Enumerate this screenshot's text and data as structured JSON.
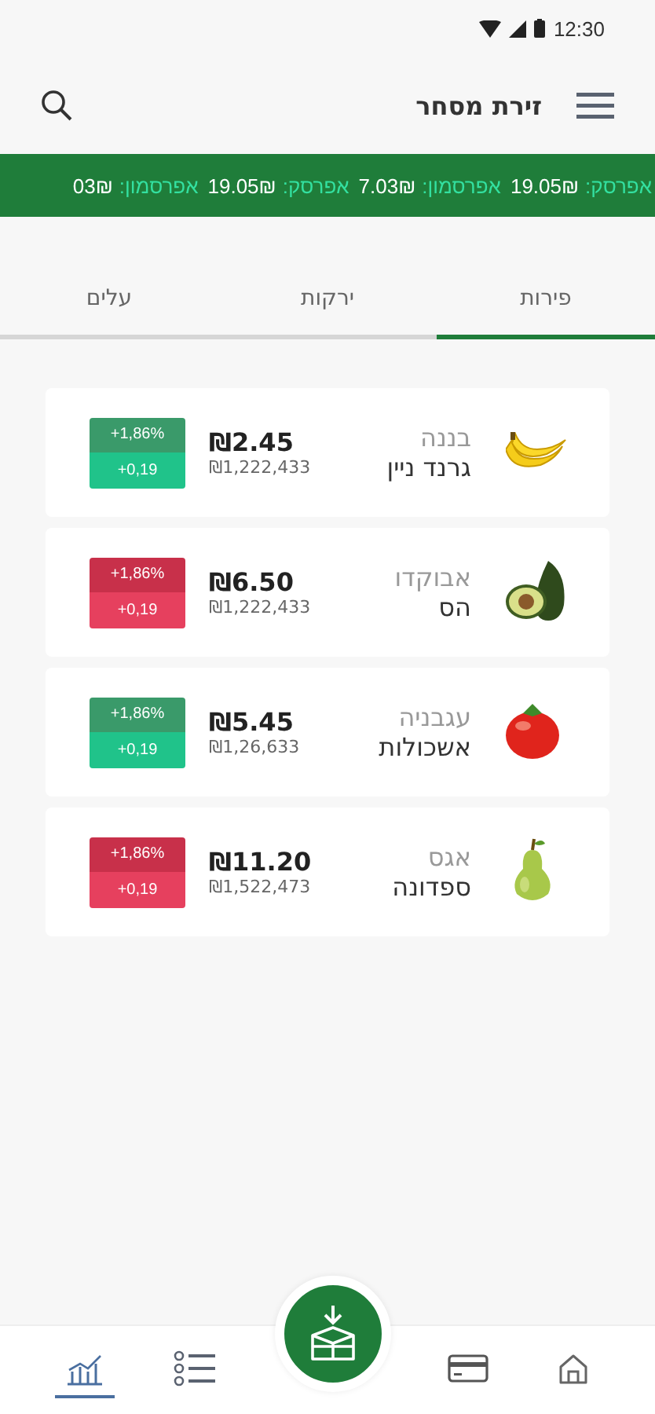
{
  "status_bar": {
    "time": "12:30"
  },
  "header": {
    "title": "זירת מסחר"
  },
  "ticker": [
    {
      "label": "אפרסק:",
      "value": "19.05₪"
    },
    {
      "label": "אפרסמון:",
      "value": "7.03₪"
    },
    {
      "label": "אפרסק:",
      "value": "19.05₪"
    },
    {
      "label": "אפרסמון:",
      "value": "03₪"
    }
  ],
  "tabs": [
    {
      "label": "פירות",
      "selected": true
    },
    {
      "label": "ירקות",
      "selected": false
    },
    {
      "label": "עלים",
      "selected": false
    }
  ],
  "products": [
    {
      "kind": "banana",
      "category": "בננה",
      "name": "גרנד ניין",
      "price": "₪2.45",
      "volume": "₪1,222,433",
      "rising": true,
      "change_percent": "+1,86%",
      "change": "+0,19"
    },
    {
      "kind": "avocado",
      "category": "אבוקדו",
      "name": "הס",
      "price": "₪6.50",
      "volume": "₪1,222,433",
      "rising": false,
      "change_percent": "+1,86%",
      "change": "+0,19"
    },
    {
      "kind": "tomato",
      "category": "עגבניה",
      "name": "אשכולות",
      "price": "₪5.45",
      "volume": "₪1,26,633",
      "rising": true,
      "change_percent": "+1,86%",
      "change": "+0,19"
    },
    {
      "kind": "pear",
      "category": "אגס",
      "name": "ספדונה",
      "price": "₪11.20",
      "volume": "₪1,522,473",
      "rising": false,
      "change_percent": "+1,86%",
      "change": "+0,19"
    }
  ],
  "bottom_nav": [
    {
      "kind": "home",
      "selected": false
    },
    {
      "kind": "card",
      "selected": false
    },
    {
      "kind": "box",
      "selected": false
    },
    {
      "kind": "list",
      "selected": false
    },
    {
      "kind": "chart",
      "selected": true
    }
  ]
}
